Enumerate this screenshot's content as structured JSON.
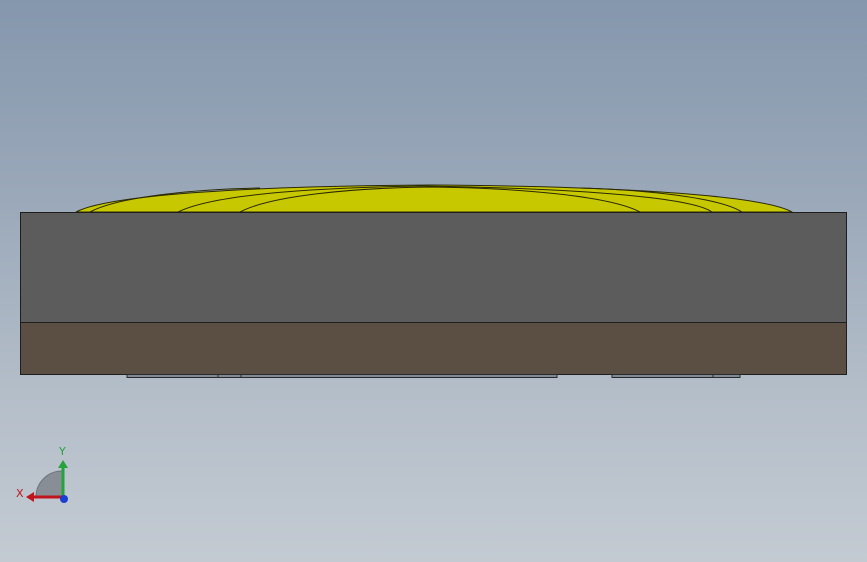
{
  "model_view": {
    "parts": [
      {
        "name": "yellow-cap",
        "color": "#c8c800"
      },
      {
        "name": "gray-body",
        "color": "#5c5c5c"
      },
      {
        "name": "brown-base",
        "color": "#5b4f43"
      }
    ]
  },
  "triad": {
    "x_label": "X",
    "y_label": "Y",
    "x_color": "#c0151d",
    "y_color": "#23a33a",
    "z_color": "#1a3fd1"
  }
}
